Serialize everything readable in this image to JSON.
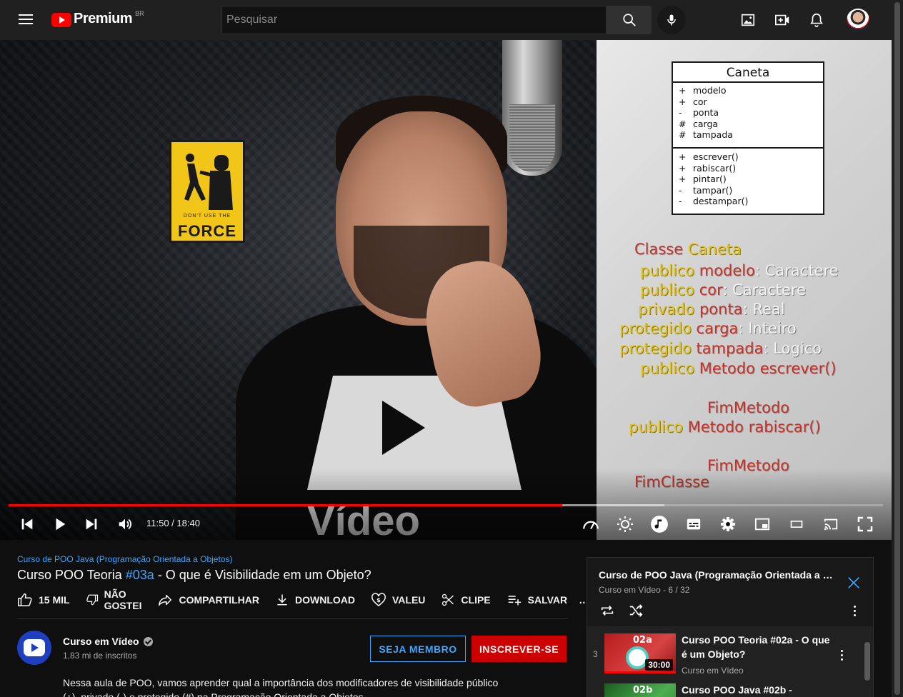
{
  "header": {
    "logo_text": "Premium",
    "region": "BR",
    "search_placeholder": "Pesquisar",
    "icons": [
      "menu-icon",
      "search-icon",
      "mic-icon",
      "image-icon",
      "create-video-icon",
      "bell-icon"
    ]
  },
  "player": {
    "time": "11:50 / 18:40",
    "progress_fraction": 0.633,
    "buffered_fraction": 0.75,
    "sign": {
      "small": "DON'T USE THE",
      "big": "FORCE"
    },
    "shirt_text": "Vídeo",
    "uml": {
      "title": "Caneta",
      "attributes": [
        {
          "sym": "+",
          "name": "modelo"
        },
        {
          "sym": "+",
          "name": "cor"
        },
        {
          "sym": "-",
          "name": "ponta"
        },
        {
          "sym": "#",
          "name": "carga"
        },
        {
          "sym": "#",
          "name": "tampada"
        }
      ],
      "methods": [
        {
          "sym": "+",
          "name": "escrever()"
        },
        {
          "sym": "+",
          "name": "rabiscar()"
        },
        {
          "sym": "+",
          "name": "pintar()"
        },
        {
          "sym": "-",
          "name": "tampar()"
        },
        {
          "sym": "-",
          "name": "destampar()"
        }
      ]
    },
    "code": {
      "classe": "Classe",
      "caneta": "Caneta",
      "l1": {
        "mod": "publico",
        "name": "modelo",
        "type": ": Caractere"
      },
      "l2": {
        "mod": "publico",
        "name": "cor",
        "type": ": Caractere"
      },
      "l3": {
        "mod": "privado",
        "name": "ponta",
        "type": ": Real"
      },
      "l4": {
        "mod": "protegido",
        "name": "carga",
        "type": ": Inteiro"
      },
      "l5": {
        "mod": "protegido",
        "name": "tampada",
        "type": ": Logico"
      },
      "l6": {
        "mod": "publico",
        "kw": "Metodo",
        "name": "escrever()"
      },
      "fim_metodo": "FimMetodo",
      "l8": {
        "mod": "publico",
        "kw": "Metodo",
        "name": "rabiscar()"
      },
      "fim_classe": "FimClasse"
    },
    "control_icons": [
      "previous-icon",
      "play-icon",
      "next-icon",
      "volume-icon",
      "speed-icon",
      "brightness-icon",
      "music-icon",
      "subtitles-icon",
      "settings-icon",
      "miniplayer-icon",
      "theater-icon",
      "cast-icon",
      "fullscreen-icon"
    ]
  },
  "video": {
    "playlist_link": "Curso de POO Java (Programação Orientada a Objetos)",
    "title_prefix": "Curso POO Teoria ",
    "title_tag": "#03a",
    "title_suffix": " - O que é Visibilidade em um Objeto?",
    "likes": "15 MIL",
    "dislike_line1": "NÃO",
    "dislike_line2": "GOSTEI",
    "share": "COMPARTILHAR",
    "download": "DOWNLOAD",
    "thanks": "VALEU",
    "clip": "CLIPE",
    "save": "SALVAR",
    "more": "..."
  },
  "channel": {
    "name": "Curso em Vídeo",
    "subs": "1,83 mi de inscritos",
    "member_btn": "SEJA MEMBRO",
    "subscribe_btn": "INSCREVER-SE",
    "description": "Nessa aula de POO, vamos aprender qual a importância dos modificadores de visibilidade público (+), privado (-) e protegido (#) na Programação Orientada a Objetos."
  },
  "playlist": {
    "title": "Curso de POO Java (Programação Orientada a Objetos)",
    "channel": "Curso em Vídeo",
    "position": "6 / 32",
    "items": [
      {
        "index": "3",
        "title": "Curso POO Teoria #02a - O que é um Objeto?",
        "channel": "Curso em Vídeo",
        "duration": "30:00",
        "thumb_label": "02a"
      },
      {
        "index": "",
        "title": "Curso POO Java #02b -",
        "channel": "",
        "duration": "",
        "thumb_label": "02b"
      }
    ]
  }
}
